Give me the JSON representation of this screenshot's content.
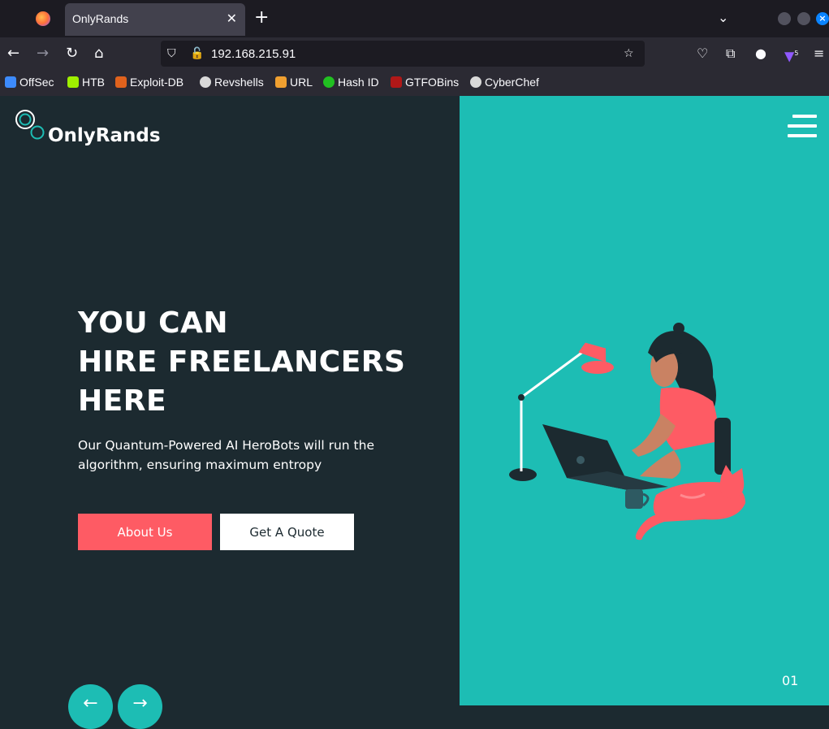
{
  "browser": {
    "tab_title": "OnlyRands",
    "tab_close": "✕",
    "new_tab": "+",
    "url": "192.168.215.91",
    "notification_badge": "5"
  },
  "bookmarks": [
    {
      "label": "OffSec",
      "color": "#3d8bfd"
    },
    {
      "label": "HTB",
      "color": "#9fef00"
    },
    {
      "label": "Exploit-DB",
      "color": "#e0621d"
    },
    {
      "label": "Revshells",
      "color": "#d9d9d9"
    },
    {
      "label": "URL",
      "color": "#f0a030"
    },
    {
      "label": "Hash ID",
      "color": "#21c021"
    },
    {
      "label": "GTFOBins",
      "color": "#b01818"
    },
    {
      "label": "CyberChef",
      "color": "#d9d9d9"
    }
  ],
  "site": {
    "logo_text": "OnlyRands",
    "hero_lines": [
      "YOU CAN",
      "HIRE FREELANCERS",
      "HERE"
    ],
    "hero_subtitle": "Our Quantum-Powered AI HeroBots will run the algorithm, ensuring maximum entropy",
    "about_button": "About Us",
    "quote_button": "Get A Quote",
    "slide_number": "01",
    "prev_arrow": "←",
    "next_arrow": "→"
  },
  "colors": {
    "dark_bg": "#1c2a30",
    "teal": "#1dbdb4",
    "coral": "#fe5b64"
  }
}
